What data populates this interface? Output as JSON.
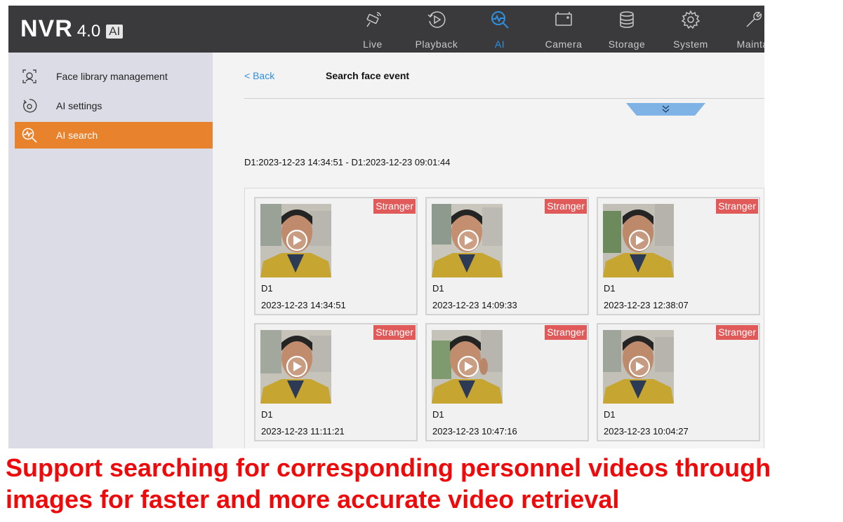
{
  "header": {
    "brand": "NVR",
    "version": "4.0",
    "badge": "AI",
    "nav": [
      {
        "label": "Live",
        "icon": "camera-signal-icon"
      },
      {
        "label": "Playback",
        "icon": "playback-icon"
      },
      {
        "label": "AI",
        "icon": "ai-search-icon",
        "active": true
      },
      {
        "label": "Camera",
        "icon": "camera-icon"
      },
      {
        "label": "Storage",
        "icon": "storage-icon"
      },
      {
        "label": "System",
        "icon": "gear-icon"
      },
      {
        "label": "Maintai",
        "icon": "wrench-icon"
      }
    ],
    "active_color": "#2d8fe0"
  },
  "sidebar": {
    "items": [
      {
        "label": "Face library management",
        "icon": "face-library-icon"
      },
      {
        "label": "AI settings",
        "icon": "ai-settings-icon"
      },
      {
        "label": "AI search",
        "icon": "ai-search-icon",
        "active": true
      }
    ],
    "active_color": "#e8822c"
  },
  "main": {
    "back_label": "< Back",
    "title": "Search face event",
    "range": "D1:2023-12-23 14:34:51 - D1:2023-12-23 09:01:44",
    "results": [
      {
        "tag": "Stranger",
        "camera": "D1",
        "time": "2023-12-23 14:34:51"
      },
      {
        "tag": "Stranger",
        "camera": "D1",
        "time": "2023-12-23 14:09:33"
      },
      {
        "tag": "Stranger",
        "camera": "D1",
        "time": "2023-12-23 12:38:07"
      },
      {
        "tag": "Stranger",
        "camera": "D1",
        "time": "2023-12-23 11:11:21"
      },
      {
        "tag": "Stranger",
        "camera": "D1",
        "time": "2023-12-23 10:47:16"
      },
      {
        "tag": "Stranger",
        "camera": "D1",
        "time": "2023-12-23 10:04:27"
      }
    ],
    "tag_color": "#e05a5a"
  },
  "caption": "Support searching for corresponding personnel videos through images for faster and more accurate video retrieval",
  "caption_color": "#ee0a0a"
}
